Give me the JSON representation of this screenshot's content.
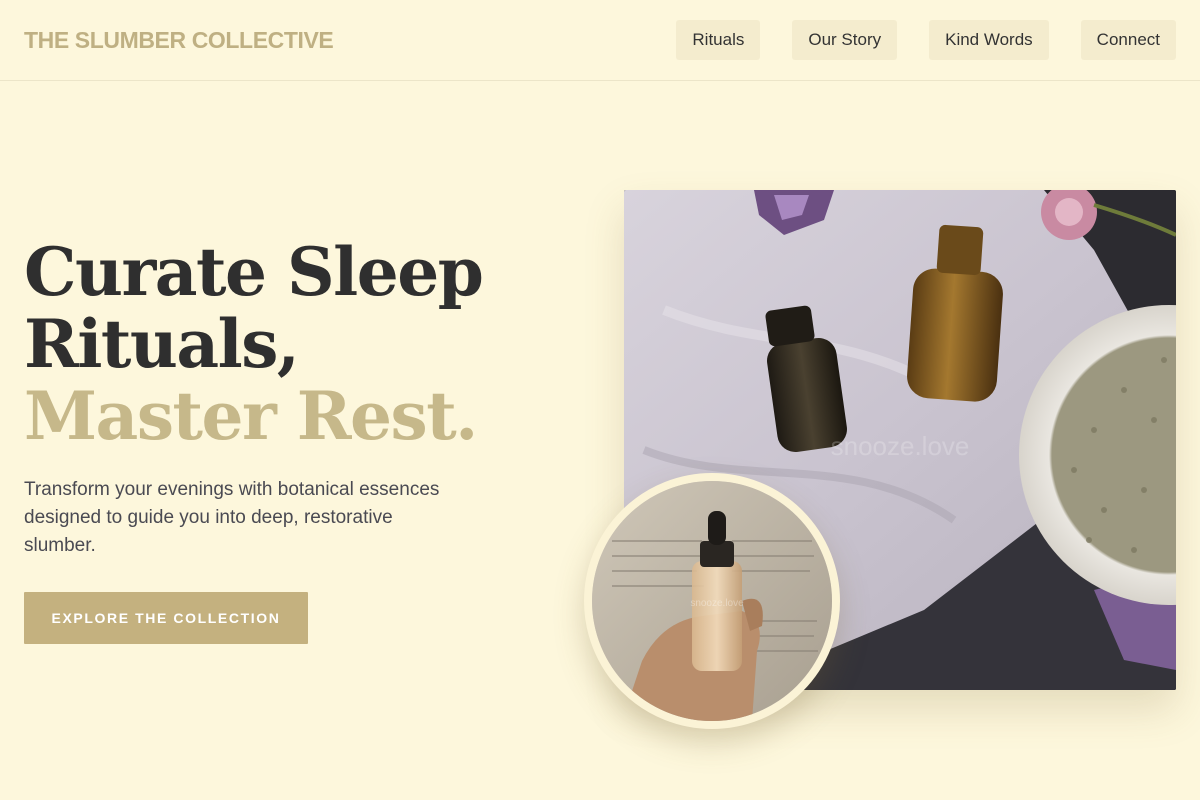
{
  "header": {
    "brand": "THE SLUMBER COLLECTIVE",
    "nav": [
      {
        "label": "Rituals"
      },
      {
        "label": "Our Story"
      },
      {
        "label": "Kind Words"
      },
      {
        "label": "Connect"
      }
    ]
  },
  "hero": {
    "title_line1": "Curate Sleep",
    "title_line2": "Rituals,",
    "title_accent": "Master Rest.",
    "description": "Transform your evenings with botanical essences designed to guide you into deep, restorative slumber.",
    "cta_label": "EXPLORE THE COLLECTION"
  },
  "images": {
    "main_watermark": "snooze.love",
    "circle_watermark": "snooze.love"
  },
  "colors": {
    "background": "#fdf7dc",
    "accent": "#c4b17f",
    "brand": "#bfb083",
    "text": "#2f2f2f"
  }
}
